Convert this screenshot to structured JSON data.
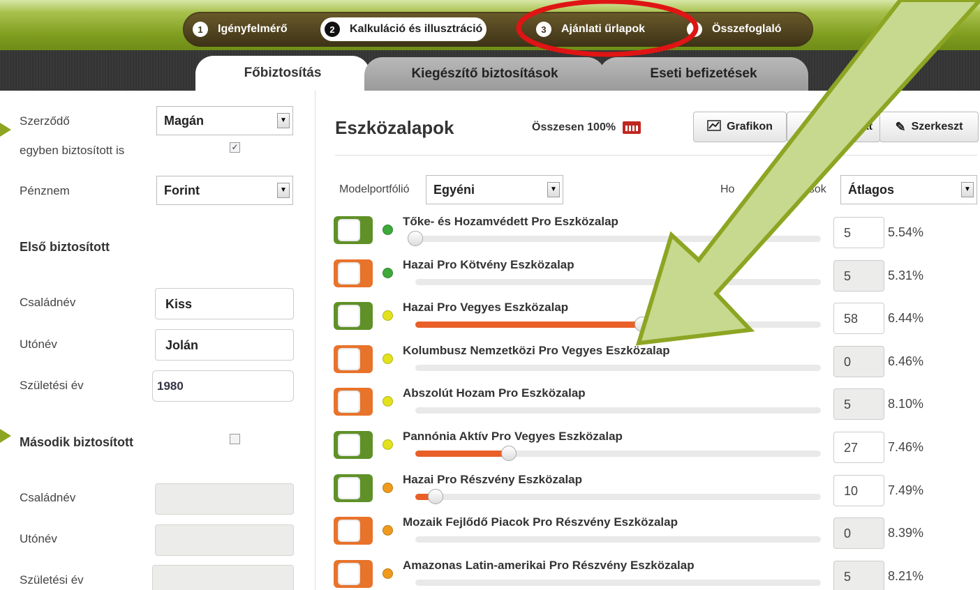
{
  "wizard": {
    "steps": [
      {
        "num": "1",
        "label": "Igényfelmérő"
      },
      {
        "num": "2",
        "label": "Kalkuláció és illusztráció"
      },
      {
        "num": "3",
        "label": "Ajánlati űrlapok"
      },
      {
        "num": "",
        "label": "Összefoglaló"
      }
    ]
  },
  "tabs": [
    "Főbiztosítás",
    "Kiegészítő biztosítások",
    "Eseti befizetések"
  ],
  "left": {
    "contractor_label": "Szerződő",
    "contractor_value": "Magán",
    "also_insured_label": "egyben biztosított is",
    "currency_label": "Pénznem",
    "currency_value": "Forint",
    "first_insured_heading": "Első biztosított",
    "family_name_label": "Családnév",
    "family_name_value": "Kiss",
    "first_name_label": "Utónév",
    "first_name_value": "Jolán",
    "birth_year_label": "Születési év",
    "birth_year_value": "1980",
    "second_insured_heading": "Második biztosított",
    "family_name2_label": "Családnév",
    "first_name2_label": "Utónév",
    "birth_year2_label": "Születési év"
  },
  "right": {
    "title": "Eszközalapok",
    "total": "Összesen 100%",
    "btn_chart": "Grafikon",
    "btn_table": "zat",
    "btn_edit": "Szerkeszt",
    "model_label": "Modelportfólió",
    "model_value": "Egyéni",
    "yield_label_a": "Ho",
    "yield_label_b": "zások",
    "yield_value": "Átlagos",
    "colors": {
      "green": "#3ea83a",
      "yellow": "#e2e21c",
      "orange": "#ee9a1c",
      "toggle_on": "#5f9128",
      "toggle_off": "#e8732b",
      "fill": "#e95f28"
    }
  },
  "funds": [
    {
      "name": "Tőke- és Hozamvédett Pro Eszközalap",
      "on": true,
      "risk": "green",
      "value": "5",
      "pct": "5.54%",
      "slider": 0
    },
    {
      "name": "Hazai Pro Kötvény Eszközalap",
      "on": false,
      "risk": "green",
      "value": "5",
      "pct": "5.31%",
      "slider": null
    },
    {
      "name": "Hazai Pro Vegyes Eszközalap",
      "on": true,
      "risk": "yellow",
      "value": "58",
      "pct": "6.44%",
      "slider": 0.56
    },
    {
      "name": "Kolumbusz Nemzetközi Pro Vegyes Eszközalap",
      "on": false,
      "risk": "yellow",
      "value": "0",
      "pct": "6.46%",
      "slider": null
    },
    {
      "name": "Abszolút Hozam Pro Eszközalap",
      "on": false,
      "risk": "yellow",
      "value": "5",
      "pct": "8.10%",
      "slider": null
    },
    {
      "name": "Pannónia Aktív Pro Vegyes Eszközalap",
      "on": true,
      "risk": "yellow",
      "value": "27",
      "pct": "7.46%",
      "slider": 0.23
    },
    {
      "name": "Hazai Pro Részvény Eszközalap",
      "on": true,
      "risk": "orange",
      "value": "10",
      "pct": "7.49%",
      "slider": 0.05
    },
    {
      "name": "Mozaik Fejlődő Piacok Pro Részvény Eszközalap",
      "on": false,
      "risk": "orange",
      "value": "0",
      "pct": "8.39%",
      "slider": null
    },
    {
      "name": "Amazonas Latin-amerikai Pro Részvény Eszközalap",
      "on": false,
      "risk": "orange",
      "value": "5",
      "pct": "8.21%",
      "slider": null
    }
  ]
}
